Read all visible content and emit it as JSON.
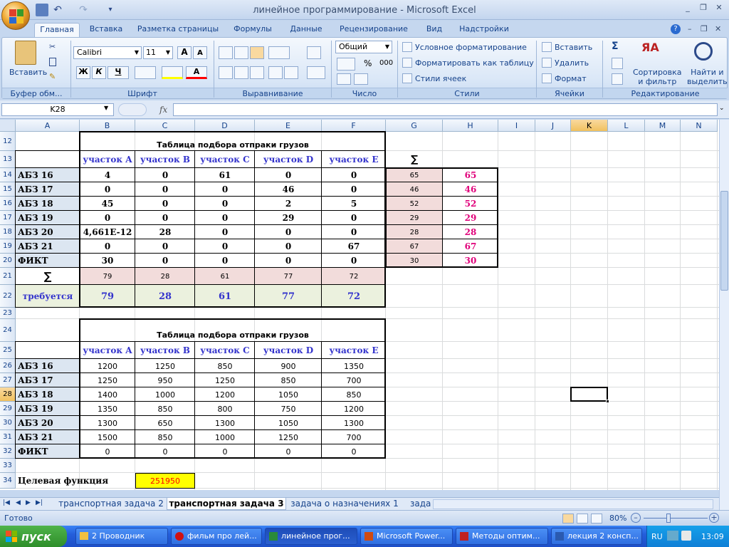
{
  "window": {
    "title": "линейное программирование - Microsoft Excel"
  },
  "ribbon_tabs": [
    "Главная",
    "Вставка",
    "Разметка страницы",
    "Формулы",
    "Данные",
    "Рецензирование",
    "Вид",
    "Надстройки"
  ],
  "ribbon": {
    "clipboard": {
      "paste": "Вставить",
      "label": "Буфер обм..."
    },
    "font": {
      "name": "Calibri",
      "size": "11",
      "bold": "Ж",
      "italic": "К",
      "underline": "Ч",
      "label": "Шрифт"
    },
    "alignment": {
      "label": "Выравнивание"
    },
    "number": {
      "format": "Общий",
      "label": "Число",
      "percent": "%",
      "thousands": "000"
    },
    "styles": {
      "conditional": "Условное форматирование",
      "as_table": "Форматировать как таблицу",
      "cell_styles": "Стили ячеек",
      "label": "Стили"
    },
    "cells": {
      "insert": "Вставить",
      "delete": "Удалить",
      "format": "Формат",
      "label": "Ячейки"
    },
    "editing": {
      "sort": "Сортировка\nи фильтр",
      "sort1": "Сортировка",
      "sort2": "и фильтр",
      "find1": "Найти и",
      "find2": "выделить",
      "label": "Редактирование",
      "sigma": "Σ"
    }
  },
  "formula_bar": {
    "name_box": "K28",
    "fx": "fx",
    "value": ""
  },
  "columns": [
    "A",
    "B",
    "C",
    "D",
    "E",
    "F",
    "G",
    "H",
    "I",
    "J",
    "K",
    "L",
    "M",
    "N"
  ],
  "rows": [
    "12",
    "13",
    "14",
    "15",
    "16",
    "17",
    "18",
    "19",
    "20",
    "21",
    "22",
    "23",
    "24",
    "25",
    "26",
    "27",
    "28",
    "29",
    "30",
    "31",
    "32",
    "33",
    "34"
  ],
  "table1": {
    "title": "Таблица подбора отпраки грузов",
    "headers": [
      "участок A",
      "участок B",
      "участок C",
      "участок D",
      "участок E"
    ],
    "sigma": "∑",
    "rows": [
      {
        "label": "АБЗ 16",
        "values": [
          "4",
          "0",
          "61",
          "0",
          "0"
        ],
        "g": "65",
        "h": "65"
      },
      {
        "label": "АБЗ 17",
        "values": [
          "0",
          "0",
          "0",
          "46",
          "0"
        ],
        "g": "46",
        "h": "46"
      },
      {
        "label": "АБЗ 18",
        "values": [
          "45",
          "0",
          "0",
          "2",
          "5"
        ],
        "g": "52",
        "h": "52"
      },
      {
        "label": "АБЗ 19",
        "values": [
          "0",
          "0",
          "0",
          "29",
          "0"
        ],
        "g": "29",
        "h": "29"
      },
      {
        "label": "АБЗ 20",
        "values": [
          "4,661E-12",
          "28",
          "0",
          "0",
          "0"
        ],
        "g": "28",
        "h": "28"
      },
      {
        "label": "АБЗ 21",
        "values": [
          "0",
          "0",
          "0",
          "0",
          "67"
        ],
        "g": "67",
        "h": "67"
      },
      {
        "label": "ФИКТ",
        "values": [
          "30",
          "0",
          "0",
          "0",
          "0"
        ],
        "g": "30",
        "h": "30"
      }
    ],
    "sum_label": "∑",
    "sums": [
      "79",
      "28",
      "61",
      "77",
      "72"
    ],
    "required_label": "требуется",
    "required": [
      "79",
      "28",
      "61",
      "77",
      "72"
    ]
  },
  "table2": {
    "title": "Таблица подбора отпраки грузов",
    "headers": [
      "участок A",
      "участок B",
      "участок C",
      "участок D",
      "участок E"
    ],
    "rows": [
      {
        "label": "АБЗ 16",
        "values": [
          "1200",
          "1250",
          "850",
          "900",
          "1350"
        ]
      },
      {
        "label": "АБЗ 17",
        "values": [
          "1250",
          "950",
          "1250",
          "850",
          "700"
        ]
      },
      {
        "label": "АБЗ 18",
        "values": [
          "1400",
          "1000",
          "1200",
          "1050",
          "850"
        ]
      },
      {
        "label": "АБЗ 19",
        "values": [
          "1350",
          "850",
          "800",
          "750",
          "1200"
        ]
      },
      {
        "label": "АБЗ 20",
        "values": [
          "1300",
          "650",
          "1300",
          "1050",
          "1300"
        ]
      },
      {
        "label": "АБЗ 21",
        "values": [
          "1500",
          "850",
          "1000",
          "1250",
          "700"
        ]
      },
      {
        "label": "ФИКТ",
        "values": [
          "0",
          "0",
          "0",
          "0",
          "0"
        ]
      }
    ]
  },
  "objective": {
    "label": "Целевая функция",
    "value": "251950"
  },
  "sheet_tabs": [
    "транспортная задача 2",
    "транспортная задача 3",
    "задача о назначениях 1",
    "зада"
  ],
  "status": {
    "ready": "Готово",
    "zoom": "80%"
  },
  "taskbar": {
    "start": "пуск",
    "items": [
      "2 Проводник",
      "фильм про лей...",
      "линейное прог...",
      "Microsoft Power...",
      "Методы оптим...",
      "лекция 2 консп..."
    ],
    "lang": "RU",
    "time": "13:09"
  },
  "colors": {
    "pink": "#f2dcdb",
    "green": "#ebf1de",
    "blue_header": "#dce6f1",
    "blue_text": "#3333cc",
    "magenta": "#e0007a",
    "yellow": "#ffff00",
    "red_text": "#ff0000"
  }
}
